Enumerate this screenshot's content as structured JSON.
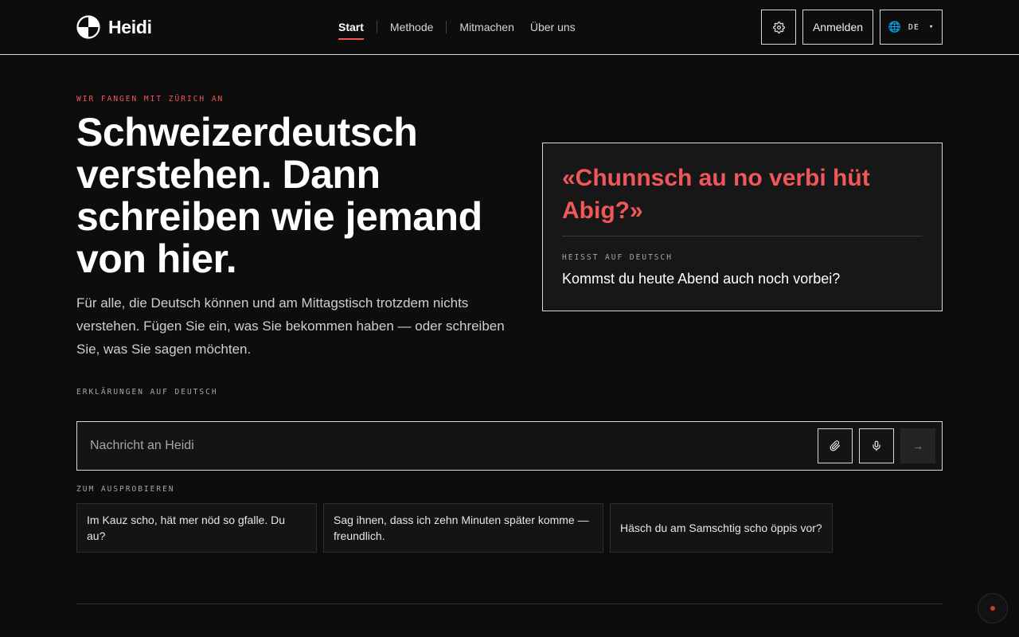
{
  "colors": {
    "accent": "#f0575a",
    "background": "#0d0d0d",
    "border": "#d9d9d9",
    "globe": "#4aa3f0"
  },
  "header": {
    "logo_text": "Heidi",
    "logo_icon": "heidi-logo-icon",
    "nav": [
      {
        "label": "Start",
        "active": true
      },
      {
        "label": "Methode",
        "active": false
      },
      {
        "label": "Mitmachen",
        "active": false
      },
      {
        "label": "Über uns",
        "active": false
      }
    ],
    "settings_icon": "gear-icon",
    "login_label": "Anmelden",
    "language": {
      "icon": "globe-icon",
      "code": "DE",
      "caret": "▾"
    }
  },
  "hero": {
    "eyebrow": "WIR FANGEN MIT ZÜRICH AN",
    "headline": "Schweizerdeutsch verstehen. Dann schreiben wie jemand von hier.",
    "lead": "Für alle, die Deutsch können und am Mittagstisch trotzdem nichts verstehen. Fügen Sie ein, was Sie bekommen haben — oder schreiben Sie, was Sie sagen möchten.",
    "explain_label": "ERKLÄRUNGEN AUF DEUTSCH"
  },
  "example_card": {
    "quote": "«Chunnsch au no verbi hüt Abig?»",
    "label": "HEISST AUF DEUTSCH",
    "translation": "Kommst du heute Abend auch noch vorbei?"
  },
  "composer": {
    "placeholder": "Nachricht an Heidi",
    "value": "",
    "attach_icon": "paperclip-icon",
    "mic_icon": "microphone-icon",
    "send_icon": "arrow-right-icon",
    "send_glyph": "→"
  },
  "suggestions": {
    "label": "ZUM AUSPROBIEREN",
    "items": [
      "Im Kauz scho, hät mer nöd so gfalle. Du au?",
      "Sag ihnen, dass ich zehn Minuten später komme — freundlich.",
      "Häsch du am Samschtig scho öppis vor?"
    ]
  }
}
